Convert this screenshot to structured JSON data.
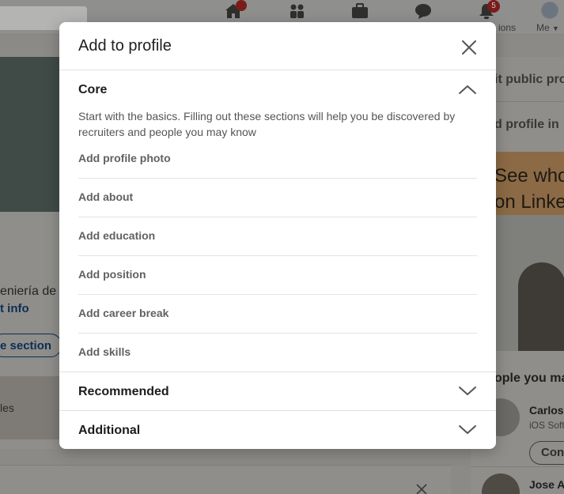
{
  "background": {
    "nav": {
      "notifications_badge": "5",
      "notifications_label": "ions",
      "me_label": "Me"
    },
    "profile_card": {
      "education_text": "eniería de",
      "contact_link": "t info",
      "add_section_button": "e section",
      "resources_text": "les"
    },
    "right_column": {
      "public_profile_link": "it public pro",
      "add_profile_lang": "d profile in",
      "ad_line1": "See who",
      "ad_line2": "on Linked",
      "people_heading": "ople you ma",
      "person1_name": "Carlos",
      "person1_subtitle": "iOS Soft",
      "connect_button": "Con",
      "person2_name": "Jose A"
    }
  },
  "modal": {
    "title": "Add to profile",
    "close_icon": "close-icon",
    "sections": {
      "core": {
        "title": "Core",
        "expanded": true,
        "description": "Start with the basics. Filling out these sections will help you be discovered by recruiters and people you may know",
        "items": [
          "Add profile photo",
          "Add about",
          "Add education",
          "Add position",
          "Add career break",
          "Add skills"
        ]
      },
      "recommended": {
        "title": "Recommended",
        "expanded": false
      },
      "additional": {
        "title": "Additional",
        "expanded": false
      }
    }
  },
  "colors": {
    "overlay_dim": "#8c8a86",
    "modal_bg": "#ffffff",
    "item_text": "#616161",
    "notification_badge": "#cc1016"
  }
}
